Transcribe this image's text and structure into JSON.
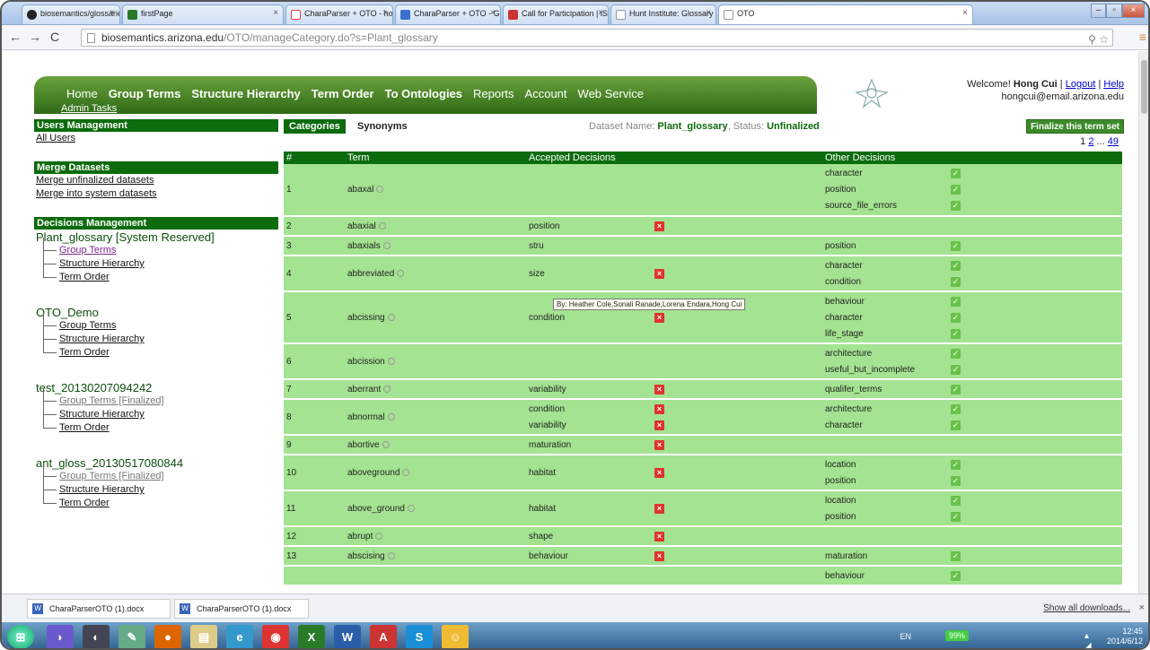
{
  "browser": {
    "tabs": [
      {
        "label": "biosemantics/glossaries",
        "color": "#222222"
      },
      {
        "label": "firstPage",
        "color": "#2a7a2a"
      },
      {
        "label": "CharaParser + OTO - hon",
        "color": "#d44"
      },
      {
        "label": "CharaParser + OTO - Goo",
        "color": "#3a6fd0"
      },
      {
        "label": "Call for Participation | iSci",
        "color": "#c33"
      },
      {
        "label": "Hunt Institute: Glossary fo",
        "color": "#bbb"
      },
      {
        "label": "OTO",
        "color": "#bbb"
      }
    ],
    "url_host": "biosemantics.arizona.edu",
    "url_path": "/OTO/manageCategory.do?s=Plant_glossary"
  },
  "nav": {
    "items": [
      "Home",
      "Group Terms",
      "Structure Hierarchy",
      "Term Order",
      "To Ontologies",
      "Reports",
      "Account",
      "Web Service"
    ],
    "admin": "Admin Tasks"
  },
  "user": {
    "welcome": "Welcome! ",
    "name": "Hong Cui",
    "logout": "Logout",
    "help": "Help",
    "email": "hongcui@email.arizona.edu"
  },
  "sidebar": {
    "users_head": "Users Management",
    "all_users": "All Users",
    "merge_head": "Merge Datasets",
    "merge_unfinalized": "Merge unfinalized datasets",
    "merge_system": "Merge into system datasets",
    "decisions_head": "Decisions Management",
    "datasets": [
      {
        "name": "Plant_glossary [System Reserved]",
        "links": [
          "Group Terms",
          "Structure Hierarchy",
          "Term Order"
        ]
      },
      {
        "name": "OTO_Demo",
        "links": [
          "Group Terms",
          "Structure Hierarchy",
          "Term Order"
        ]
      },
      {
        "name": "test_20130207094242",
        "links": [
          "Group Terms [Finalized]",
          "Structure Hierarchy",
          "Term Order"
        ]
      },
      {
        "name": "ant_gloss_20130517080844",
        "links": [
          "Group Terms [Finalized]",
          "Structure Hierarchy",
          "Term Order"
        ]
      }
    ]
  },
  "main": {
    "tab_categories": "Categories",
    "tab_synonyms": "Synonyms",
    "dataset_label": "Dataset Name: ",
    "dataset_name": "Plant_glossary",
    "status_label": ", Status: ",
    "status": "Unfinalized",
    "finalize": "Finalize this term set",
    "pager": [
      "1",
      "2",
      "...",
      "49"
    ],
    "headers": [
      "#",
      "Term",
      "Accepted Decisions",
      "Other Decisions"
    ],
    "tooltip": "By: Heather Cole,Sonali Ranade,Lorena  Endara,Hong Cui",
    "rows": [
      {
        "n": "1",
        "term": "abaxal",
        "accepted": [],
        "other": [
          "character",
          "position",
          "source_file_errors"
        ]
      },
      {
        "n": "2",
        "term": "abaxial",
        "accepted": [
          "position"
        ],
        "other": []
      },
      {
        "n": "3",
        "term": "abaxials",
        "accepted": [
          "stru"
        ],
        "other": [
          "position"
        ]
      },
      {
        "n": "4",
        "term": "abbreviated",
        "accepted": [
          "size"
        ],
        "other": [
          "character",
          "condition"
        ]
      },
      {
        "n": "5",
        "term": "abcissing",
        "accepted": [
          "condition"
        ],
        "other": [
          "behaviour",
          "character",
          "life_stage"
        ]
      },
      {
        "n": "6",
        "term": "abcission",
        "accepted": [],
        "other": [
          "architecture",
          "useful_but_incomplete"
        ]
      },
      {
        "n": "7",
        "term": "aberrant",
        "accepted": [
          "variability"
        ],
        "other": [
          "qualifer_terms"
        ]
      },
      {
        "n": "8",
        "term": "abnormal",
        "accepted": [
          "condition",
          "variability"
        ],
        "other": [
          "architecture",
          "character"
        ]
      },
      {
        "n": "9",
        "term": "abortive",
        "accepted": [
          "maturation"
        ],
        "other": []
      },
      {
        "n": "10",
        "term": "aboveground",
        "accepted": [
          "habitat"
        ],
        "other": [
          "location",
          "position"
        ]
      },
      {
        "n": "11",
        "term": "above_ground",
        "accepted": [
          "habitat"
        ],
        "other": [
          "location",
          "position"
        ]
      },
      {
        "n": "12",
        "term": "abrupt",
        "accepted": [
          "shape"
        ],
        "other": []
      },
      {
        "n": "13",
        "term": "abscising",
        "accepted": [
          "behaviour"
        ],
        "other": [
          "maturation"
        ]
      },
      {
        "n": "",
        "term": "",
        "accepted": [],
        "other": [
          "behaviour"
        ]
      }
    ]
  },
  "downloads": {
    "items": [
      "CharaParserOTO (1).docx",
      "CharaParserOTO (1).docx"
    ],
    "show_all": "Show all downloads..."
  },
  "taskbar": {
    "lang": "EN",
    "battery": "99%",
    "time": "12:45",
    "date": "2014/6/12"
  }
}
